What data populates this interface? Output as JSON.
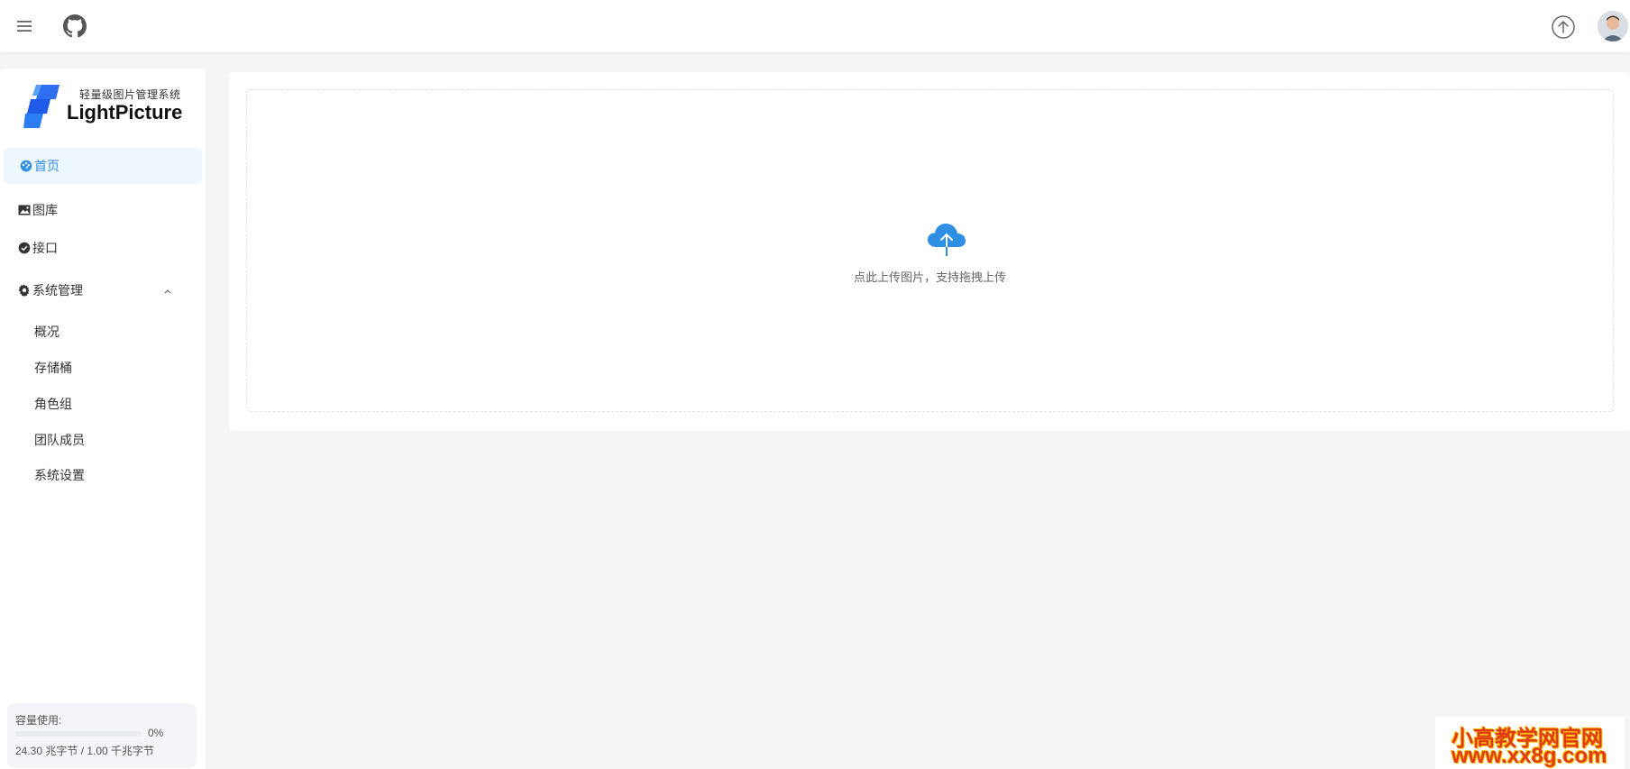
{
  "header": {
    "menu_icon": "menu-icon",
    "github_icon": "github-icon",
    "upload_icon": "upload-circle-icon",
    "avatar": "avatar"
  },
  "sidebar": {
    "logo_subtitle": "轻量级图片管理系统",
    "logo_title": "LightPicture",
    "items": [
      {
        "label": "首页",
        "icon": "dashboard-icon",
        "active": true
      },
      {
        "label": "图库",
        "icon": "image-icon"
      },
      {
        "label": "接口",
        "icon": "check-circle-icon"
      },
      {
        "label": "系统管理",
        "icon": "gear-icon",
        "expanded": true
      }
    ],
    "sub_items": [
      "概况",
      "存储桶",
      "角色组",
      "团队成员",
      "系统设置"
    ],
    "usage": {
      "label": "容量使用:",
      "percent_text": "0%",
      "percent": 0,
      "size_text": "24.30 兆字节 / 1.00 千兆字节"
    }
  },
  "main": {
    "upload_hint": "点此上传图片，支持拖拽上传"
  },
  "watermark": {
    "line1": "小高教学网官网",
    "line2": "www.xx8g.com"
  },
  "colors": {
    "accent": "#2f8fe4",
    "background": "#f4f5f7",
    "active_bg": "#eef7fd"
  }
}
